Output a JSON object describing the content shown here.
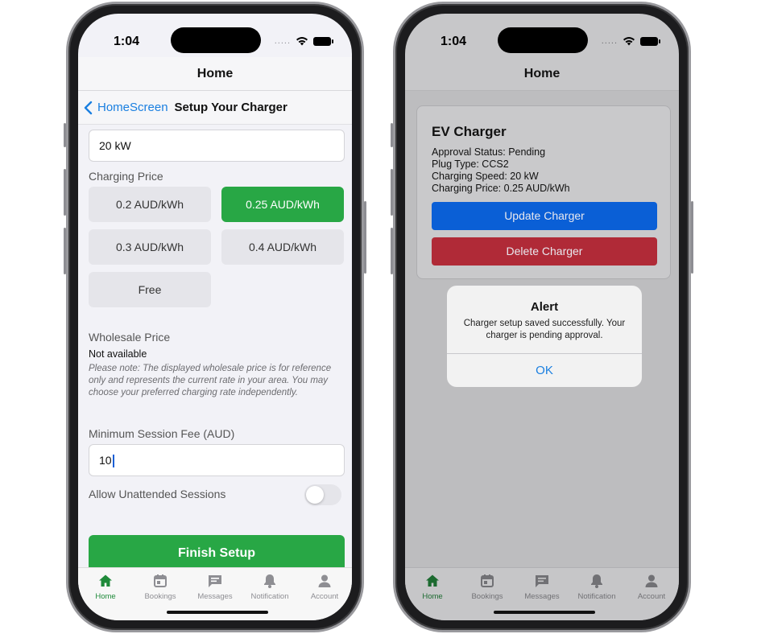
{
  "colors": {
    "accent_green": "#28a745",
    "link_blue": "#1a7fe0",
    "update_blue": "#0a5fd6",
    "delete_red": "#b02a37"
  },
  "left": {
    "status": {
      "time": "1:04",
      "dots": "....."
    },
    "nav_title": "Home",
    "subnav": {
      "back_label": "HomeScreen",
      "title": "Setup Your Charger"
    },
    "charging_speed_value": "20 kW",
    "charging_price": {
      "label": "Charging Price",
      "options": [
        "0.2 AUD/kWh",
        "0.25 AUD/kWh",
        "0.3 AUD/kWh",
        "0.4 AUD/kWh",
        "Free"
      ],
      "selected": "0.25 AUD/kWh"
    },
    "wholesale": {
      "label": "Wholesale Price",
      "value": "Not available",
      "note": "Please note: The displayed wholesale price is for reference only and represents the current rate in your area. You may choose your preferred charging rate independently."
    },
    "min_fee": {
      "label": "Minimum Session Fee (AUD)",
      "value": "10"
    },
    "unattended": {
      "label": "Allow Unattended Sessions",
      "enabled": false
    },
    "finish_button": "Finish Setup"
  },
  "right": {
    "status": {
      "time": "1:04",
      "dots": "....."
    },
    "nav_title": "Home",
    "card": {
      "title": "EV Charger",
      "approval_status": "Approval Status: Pending",
      "plug_type": "Plug Type: CCS2",
      "charging_speed": "Charging Speed: 20 kW",
      "charging_price": "Charging Price: 0.25 AUD/kWh",
      "update_button": "Update Charger",
      "delete_button": "Delete Charger"
    },
    "alert": {
      "title": "Alert",
      "message": "Charger setup saved successfully. Your charger is pending approval.",
      "ok": "OK"
    }
  },
  "tabs": [
    {
      "label": "Home",
      "icon": "home-icon",
      "active": true
    },
    {
      "label": "Bookings",
      "icon": "calendar-icon",
      "active": false
    },
    {
      "label": "Messages",
      "icon": "message-icon",
      "active": false
    },
    {
      "label": "Notification",
      "icon": "bell-icon",
      "active": false
    },
    {
      "label": "Account",
      "icon": "person-icon",
      "active": false
    }
  ]
}
